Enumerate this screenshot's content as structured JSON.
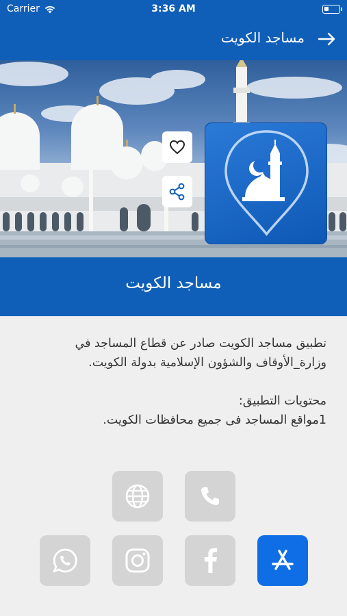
{
  "status_bar": {
    "carrier": "Carrier",
    "time": "3:36 AM"
  },
  "nav": {
    "title": "مساجد الكويت",
    "back_icon": "arrow-right-icon"
  },
  "hero": {
    "app_icon": "mosque-pin-icon",
    "actions": [
      "heart-icon",
      "share-icon"
    ]
  },
  "app": {
    "title": "مساجد الكويت"
  },
  "description": {
    "paragraph": "تطبيق مساجد الكويت صادر عن قطاع المساجد في وزارة_الأوقاف والشؤون الإسلامية بدولة الكويت.",
    "contents_heading": "محتويات التطبيق:",
    "contents_item": "1مواقع المساجد فى جميع محافظات الكويت."
  },
  "links": {
    "row1": [
      "globe-icon",
      "phone-icon"
    ],
    "row2": [
      "whatsapp-icon",
      "instagram-icon",
      "facebook-icon",
      "app-store-icon"
    ]
  },
  "colors": {
    "primary": "#0f5fb8",
    "accent": "#0f6ee6",
    "button_bg": "#d4d4d4",
    "background": "#efefef"
  }
}
